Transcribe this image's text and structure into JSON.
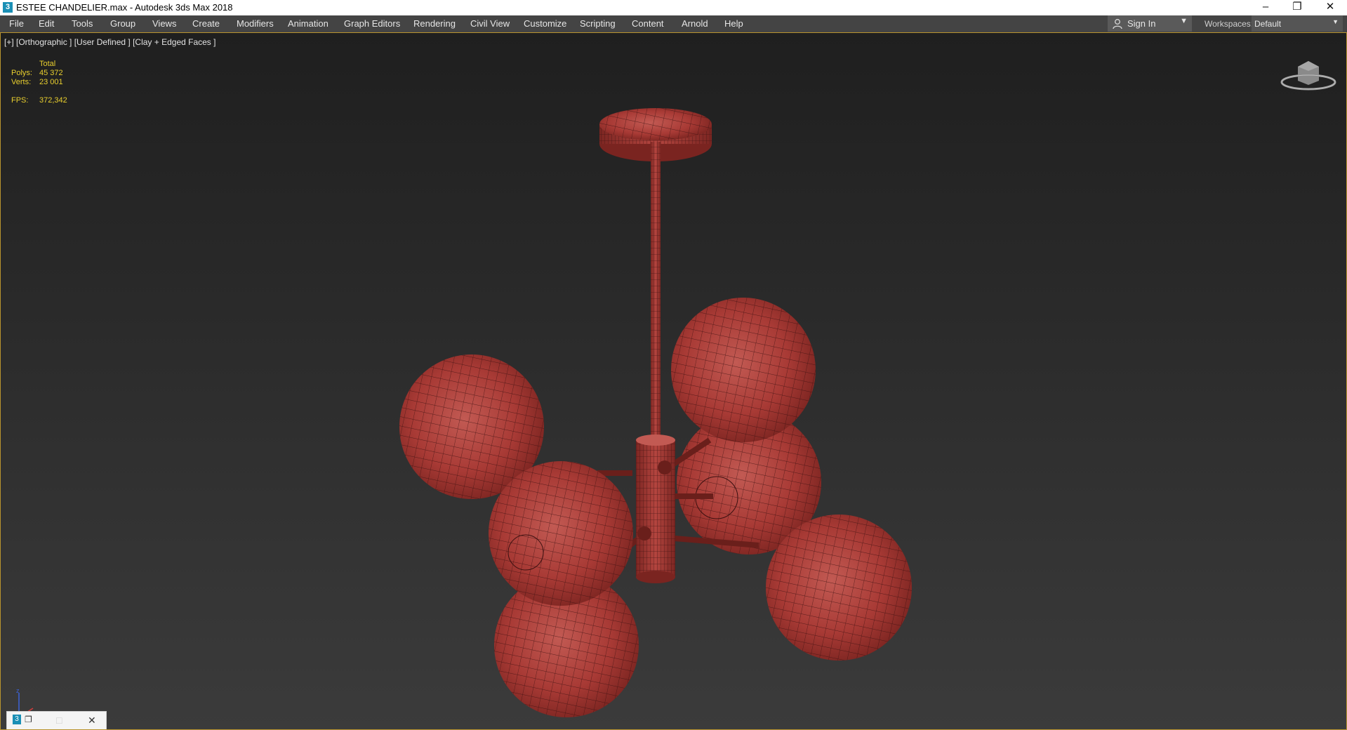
{
  "window": {
    "title": "ESTEE CHANDELIER.max - Autodesk 3ds Max 2018",
    "icon_text": "3",
    "controls": [
      "minimize-icon",
      "restore-icon",
      "close-icon"
    ]
  },
  "menubar": {
    "items": [
      "File",
      "Edit",
      "Tools",
      "Group",
      "Views",
      "Create",
      "Modifiers",
      "Animation",
      "Graph Editors",
      "Rendering",
      "Civil View",
      "Customize",
      "Scripting",
      "Content",
      "Arnold",
      "Help"
    ],
    "sign_in": "Sign In",
    "workspaces_label": "Workspaces:",
    "workspace_value": "Default"
  },
  "viewport": {
    "label": "[+] [Orthographic ] [User Defined ] [Clay + Edged Faces ]",
    "stats": {
      "header": "Total",
      "polys_label": "Polys:",
      "polys_value": "45 372",
      "verts_label": "Verts:",
      "verts_value": "23 001",
      "fps_label": "FPS:",
      "fps_value": "372,342"
    },
    "axis_label": "z",
    "model_color": "#a83a35"
  },
  "minimized_window": {
    "icons": [
      "app-icon",
      "restore-icon",
      "maximize-icon",
      "close-icon"
    ]
  },
  "colors": {
    "accent": "#b9942e",
    "menubar_bg": "#444444",
    "stats_text": "#e9cf2e"
  }
}
